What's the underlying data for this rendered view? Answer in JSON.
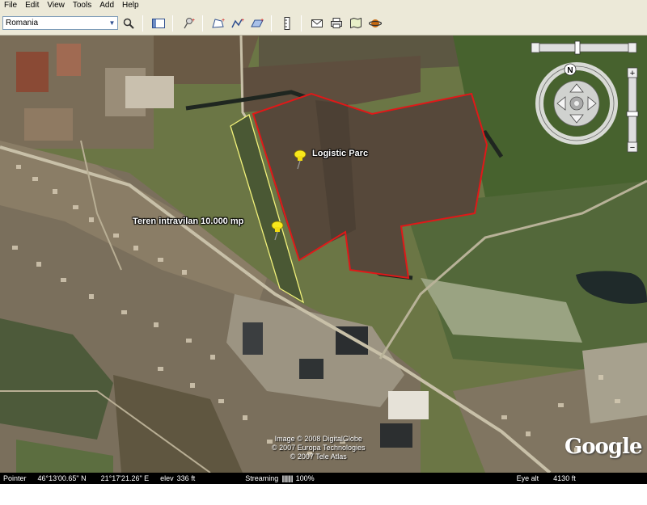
{
  "menu": [
    "File",
    "Edit",
    "View",
    "Tools",
    "Add",
    "Help"
  ],
  "search": {
    "value": "Romania"
  },
  "map": {
    "placemarks": [
      {
        "label": "Logistic Parc"
      },
      {
        "label": "Teren intravilan 10.000 mp"
      }
    ],
    "credits": [
      "Image © 2008 DigitalGlobe",
      "© 2007 Europa Technologies",
      "© 2007 Tele Atlas"
    ],
    "logo": "Google",
    "compass_letter": "N",
    "zoom_plus": "+",
    "zoom_minus": "−"
  },
  "status": {
    "pointer_label": "Pointer",
    "lat": "46°13'00.65\" N",
    "lon": "21°17'21.26\" E",
    "elev_label": "elev",
    "elev": "336 ft",
    "streaming_label": "Streaming",
    "streaming_bars": "||||||||||",
    "streaming_pct": "100%",
    "eye_alt_label": "Eye alt",
    "eye_alt": "4130 ft"
  },
  "colors": {
    "parcel_outline": "#e01818",
    "plot_outline": "#f2f27a",
    "pin": "#f8e81c"
  }
}
